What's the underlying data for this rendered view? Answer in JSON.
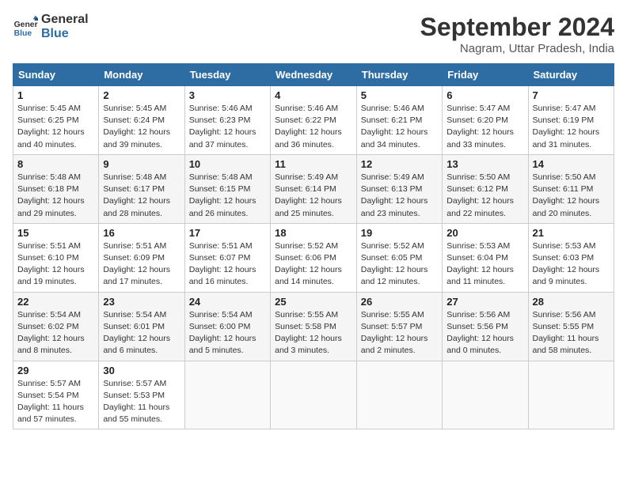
{
  "header": {
    "logo_line1": "General",
    "logo_line2": "Blue",
    "month_title": "September 2024",
    "location": "Nagram, Uttar Pradesh, India"
  },
  "weekdays": [
    "Sunday",
    "Monday",
    "Tuesday",
    "Wednesday",
    "Thursday",
    "Friday",
    "Saturday"
  ],
  "weeks": [
    [
      {
        "day": "1",
        "info": "Sunrise: 5:45 AM\nSunset: 6:25 PM\nDaylight: 12 hours\nand 40 minutes."
      },
      {
        "day": "2",
        "info": "Sunrise: 5:45 AM\nSunset: 6:24 PM\nDaylight: 12 hours\nand 39 minutes."
      },
      {
        "day": "3",
        "info": "Sunrise: 5:46 AM\nSunset: 6:23 PM\nDaylight: 12 hours\nand 37 minutes."
      },
      {
        "day": "4",
        "info": "Sunrise: 5:46 AM\nSunset: 6:22 PM\nDaylight: 12 hours\nand 36 minutes."
      },
      {
        "day": "5",
        "info": "Sunrise: 5:46 AM\nSunset: 6:21 PM\nDaylight: 12 hours\nand 34 minutes."
      },
      {
        "day": "6",
        "info": "Sunrise: 5:47 AM\nSunset: 6:20 PM\nDaylight: 12 hours\nand 33 minutes."
      },
      {
        "day": "7",
        "info": "Sunrise: 5:47 AM\nSunset: 6:19 PM\nDaylight: 12 hours\nand 31 minutes."
      }
    ],
    [
      {
        "day": "8",
        "info": "Sunrise: 5:48 AM\nSunset: 6:18 PM\nDaylight: 12 hours\nand 29 minutes."
      },
      {
        "day": "9",
        "info": "Sunrise: 5:48 AM\nSunset: 6:17 PM\nDaylight: 12 hours\nand 28 minutes."
      },
      {
        "day": "10",
        "info": "Sunrise: 5:48 AM\nSunset: 6:15 PM\nDaylight: 12 hours\nand 26 minutes."
      },
      {
        "day": "11",
        "info": "Sunrise: 5:49 AM\nSunset: 6:14 PM\nDaylight: 12 hours\nand 25 minutes."
      },
      {
        "day": "12",
        "info": "Sunrise: 5:49 AM\nSunset: 6:13 PM\nDaylight: 12 hours\nand 23 minutes."
      },
      {
        "day": "13",
        "info": "Sunrise: 5:50 AM\nSunset: 6:12 PM\nDaylight: 12 hours\nand 22 minutes."
      },
      {
        "day": "14",
        "info": "Sunrise: 5:50 AM\nSunset: 6:11 PM\nDaylight: 12 hours\nand 20 minutes."
      }
    ],
    [
      {
        "day": "15",
        "info": "Sunrise: 5:51 AM\nSunset: 6:10 PM\nDaylight: 12 hours\nand 19 minutes."
      },
      {
        "day": "16",
        "info": "Sunrise: 5:51 AM\nSunset: 6:09 PM\nDaylight: 12 hours\nand 17 minutes."
      },
      {
        "day": "17",
        "info": "Sunrise: 5:51 AM\nSunset: 6:07 PM\nDaylight: 12 hours\nand 16 minutes."
      },
      {
        "day": "18",
        "info": "Sunrise: 5:52 AM\nSunset: 6:06 PM\nDaylight: 12 hours\nand 14 minutes."
      },
      {
        "day": "19",
        "info": "Sunrise: 5:52 AM\nSunset: 6:05 PM\nDaylight: 12 hours\nand 12 minutes."
      },
      {
        "day": "20",
        "info": "Sunrise: 5:53 AM\nSunset: 6:04 PM\nDaylight: 12 hours\nand 11 minutes."
      },
      {
        "day": "21",
        "info": "Sunrise: 5:53 AM\nSunset: 6:03 PM\nDaylight: 12 hours\nand 9 minutes."
      }
    ],
    [
      {
        "day": "22",
        "info": "Sunrise: 5:54 AM\nSunset: 6:02 PM\nDaylight: 12 hours\nand 8 minutes."
      },
      {
        "day": "23",
        "info": "Sunrise: 5:54 AM\nSunset: 6:01 PM\nDaylight: 12 hours\nand 6 minutes."
      },
      {
        "day": "24",
        "info": "Sunrise: 5:54 AM\nSunset: 6:00 PM\nDaylight: 12 hours\nand 5 minutes."
      },
      {
        "day": "25",
        "info": "Sunrise: 5:55 AM\nSunset: 5:58 PM\nDaylight: 12 hours\nand 3 minutes."
      },
      {
        "day": "26",
        "info": "Sunrise: 5:55 AM\nSunset: 5:57 PM\nDaylight: 12 hours\nand 2 minutes."
      },
      {
        "day": "27",
        "info": "Sunrise: 5:56 AM\nSunset: 5:56 PM\nDaylight: 12 hours\nand 0 minutes."
      },
      {
        "day": "28",
        "info": "Sunrise: 5:56 AM\nSunset: 5:55 PM\nDaylight: 11 hours\nand 58 minutes."
      }
    ],
    [
      {
        "day": "29",
        "info": "Sunrise: 5:57 AM\nSunset: 5:54 PM\nDaylight: 11 hours\nand 57 minutes."
      },
      {
        "day": "30",
        "info": "Sunrise: 5:57 AM\nSunset: 5:53 PM\nDaylight: 11 hours\nand 55 minutes."
      },
      {
        "day": "",
        "info": ""
      },
      {
        "day": "",
        "info": ""
      },
      {
        "day": "",
        "info": ""
      },
      {
        "day": "",
        "info": ""
      },
      {
        "day": "",
        "info": ""
      }
    ]
  ]
}
